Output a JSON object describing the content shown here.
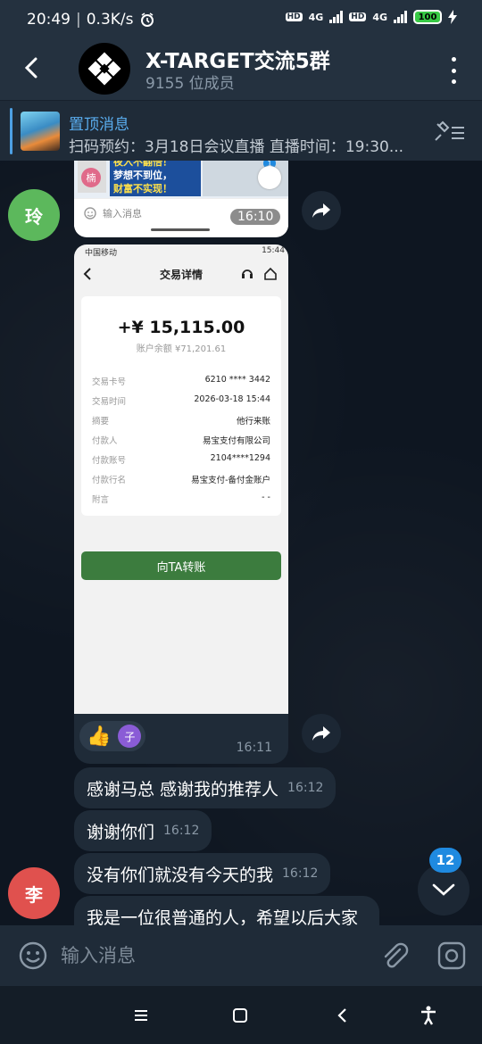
{
  "status_bar": {
    "time": "20:49",
    "speed": "0.3K/s",
    "battery": "100",
    "net1": "4G",
    "net2": "4G",
    "hd": "HD"
  },
  "header": {
    "title": "X-TARGET交流5群",
    "subtitle": "9155 位成员"
  },
  "pinned": {
    "title": "置顶消息",
    "text": "扫码预约：3月18日会议直播 直播时间：19:30..."
  },
  "messages": {
    "avatar1": "玲",
    "avatar2": "李",
    "img1_time": "16:10",
    "img1_input_placeholder": "输入消息",
    "img1_text1": "夜入不翻倍！",
    "img1_text2": "梦想不到位，",
    "img1_text3": "财富不实现！",
    "img1_avatar": "楠",
    "img1_badge": "1",
    "receipt": {
      "carrier": "中国移动",
      "status_time": "15:44",
      "title": "交易详情",
      "amount": "+¥ 15,115.00",
      "balance": "账户余额 ¥71,201.61",
      "rows": [
        {
          "k": "交易卡号",
          "v": "6210 **** 3442"
        },
        {
          "k": "交易时间",
          "v": "2026-03-18 15:44"
        },
        {
          "k": "摘要",
          "v": "他行来账"
        },
        {
          "k": "付款人",
          "v": "易宝支付有限公司"
        },
        {
          "k": "付款账号",
          "v": "2104****1294"
        },
        {
          "k": "付款行名",
          "v": "易宝支付-备付金账户"
        },
        {
          "k": "附言",
          "v": "- -"
        }
      ],
      "button": "向TA转账"
    },
    "reaction_emoji": "👍",
    "reaction_user": "子",
    "img2_time": "16:11",
    "texts": [
      {
        "text": "感谢马总 感谢我的推荐人",
        "time": "16:12"
      },
      {
        "text": "谢谢你们",
        "time": "16:12"
      },
      {
        "text": "没有你们就没有今天的我",
        "time": "16:12"
      },
      {
        "text": "我是一位很普通的人，希望以后大家",
        "time": ""
      }
    ],
    "unread_count": "12"
  },
  "input": {
    "placeholder": "输入消息"
  },
  "colors": {
    "header_bg": "#24313f",
    "chat_bg": "#0e1621",
    "bubble": "#1f2b38",
    "accent": "#5aaef0",
    "avatar1": "#5cb85c",
    "avatar2": "#e0514e",
    "badge": "#1f8ae0"
  }
}
